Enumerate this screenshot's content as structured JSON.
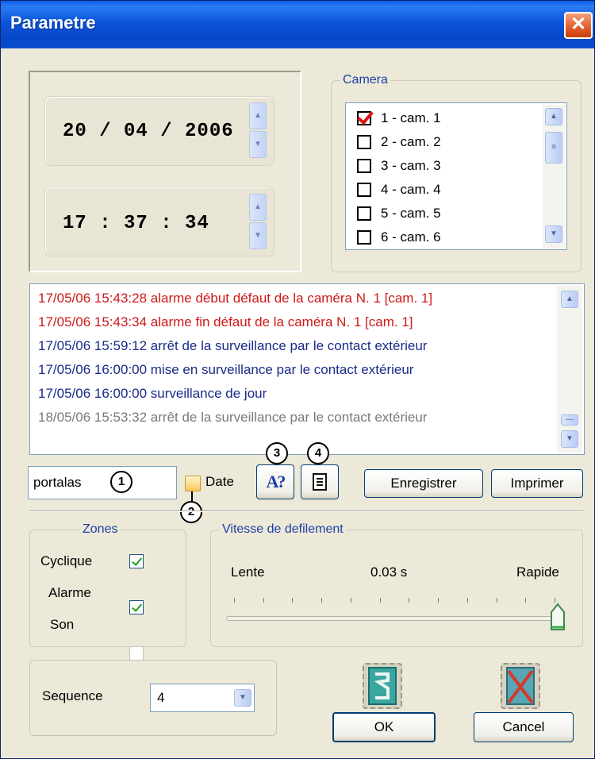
{
  "window": {
    "title": "Parametre",
    "close_glyph": "✕"
  },
  "datetime": {
    "date": "20 / 04 / 2006",
    "time": "17 : 37 : 34"
  },
  "camera": {
    "legend": "Camera",
    "items": [
      {
        "label": "1 - cam. 1",
        "checked": true
      },
      {
        "label": "2 - cam. 2",
        "checked": false
      },
      {
        "label": "3 - cam. 3",
        "checked": false
      },
      {
        "label": "4 - cam. 4",
        "checked": false
      },
      {
        "label": "5 - cam. 5",
        "checked": false
      },
      {
        "label": "6 - cam. 6",
        "checked": false
      }
    ]
  },
  "log": {
    "lines": [
      {
        "text": "17/05/06 15:43:28 alarme début défaut de la caméra N. 1 [cam. 1]",
        "color": "#d01818"
      },
      {
        "text": "17/05/06 15:43:34 alarme fin défaut de la caméra N. 1 [cam. 1]",
        "color": "#d01818"
      },
      {
        "text": "17/05/06 15:59:12 arrêt de la surveillance par le contact extérieur",
        "color": "#1a2a8a"
      },
      {
        "text": "17/05/06 16:00:00 mise en surveillance par le contact extérieur",
        "color": "#1a2a8a"
      },
      {
        "text": "17/05/06 16:00:00 surveillance de jour",
        "color": "#1a2a8a"
      },
      {
        "text": "18/05/06 15:53:32 arrêt de la surveillance par le contact extérieur",
        "color": "#7a7a7a"
      }
    ]
  },
  "filter": {
    "value": "portalas",
    "date_label": "Date",
    "callouts": [
      "1",
      "2",
      "3",
      "4"
    ]
  },
  "buttons": {
    "save": "Enregistrer",
    "print": "Imprimer",
    "ok": "OK",
    "cancel": "Cancel"
  },
  "zones": {
    "legend": "Zones",
    "items": [
      {
        "label": "Cyclique",
        "checked": true
      },
      {
        "label": "Alarme",
        "checked": true
      },
      {
        "label": "Son",
        "checked": false
      }
    ]
  },
  "speed": {
    "legend": "Vitesse de defilement",
    "slow": "Lente",
    "value": "0.03 s",
    "fast": "Rapide",
    "slider_level": 1.0
  },
  "sequence": {
    "label": "Sequence",
    "value": "4"
  },
  "icons": {
    "find": "A?",
    "report": "document-icon"
  }
}
